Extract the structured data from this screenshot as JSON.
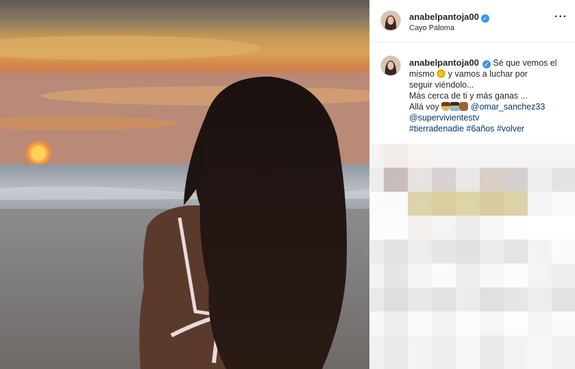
{
  "post": {
    "author": "anabelpantoja00",
    "verified": true,
    "location": "Cayo Paloma",
    "more_icon": "more-horizontal-icon"
  },
  "caption": {
    "author": "anabelpantoja00",
    "line1_a": "Sé que vemos el",
    "line2_a": "mismo",
    "line2_b": "y vamos a luchar por",
    "line3": "seguir viéndolo...",
    "line4": "Más cerca de ti y más ganas ...",
    "line5_a": "Allá voy",
    "mention1": "@omar_sanchez33",
    "mention2": "@supervivientestv",
    "hashtag1": "#tierradenadie",
    "hashtag2": "#6años",
    "hashtag3": "#volver"
  },
  "colors": {
    "link": "#00376b",
    "verified": "#3897f0",
    "border": "#efefef"
  }
}
